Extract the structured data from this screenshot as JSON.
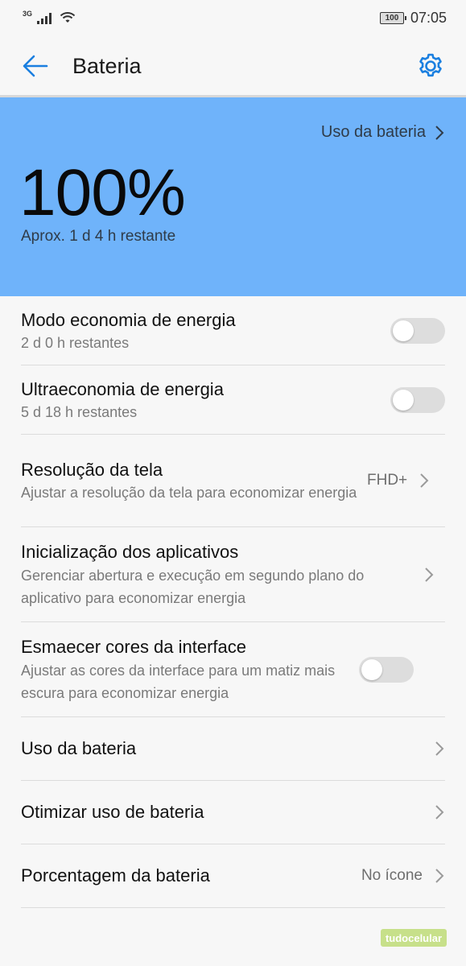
{
  "status_bar": {
    "network": "3G",
    "battery_level": "100",
    "time": "07:05"
  },
  "header": {
    "title": "Bateria",
    "back_icon": "arrow-left-icon",
    "settings_icon": "gear-icon",
    "accent_color": "#1a7fe0"
  },
  "hero": {
    "usage_link_label": "Uso da bateria",
    "percentage": "100%",
    "remaining": "Aprox. 1 d 4 h restante",
    "background_color": "#6fb3fa"
  },
  "items": [
    {
      "title": "Modo economia de energia",
      "subtitle": "2 d 0 h restantes",
      "control": "toggle",
      "on": false
    },
    {
      "title": "Ultraeconomia de energia",
      "subtitle": "5 d 18 h restantes",
      "control": "toggle",
      "on": false
    },
    {
      "title": "Resolução da tela",
      "subtitle": "Ajustar a resolução da tela para economizar energia",
      "value": "FHD+",
      "control": "chevron"
    },
    {
      "title": "Inicialização dos aplicativos",
      "subtitle": "Gerenciar abertura e execução em segundo plano do aplicativo para economizar energia",
      "control": "chevron"
    },
    {
      "title": "Esmaecer cores da interface",
      "subtitle": "Ajustar as cores da interface para um matiz mais escura para economizar energia",
      "control": "toggle",
      "on": false
    },
    {
      "title": "Uso da bateria",
      "control": "chevron"
    },
    {
      "title": "Otimizar uso de bateria",
      "control": "chevron"
    },
    {
      "title": "Porcentagem da bateria",
      "value": "No ícone",
      "control": "chevron"
    }
  ],
  "watermark": "tudocelular"
}
